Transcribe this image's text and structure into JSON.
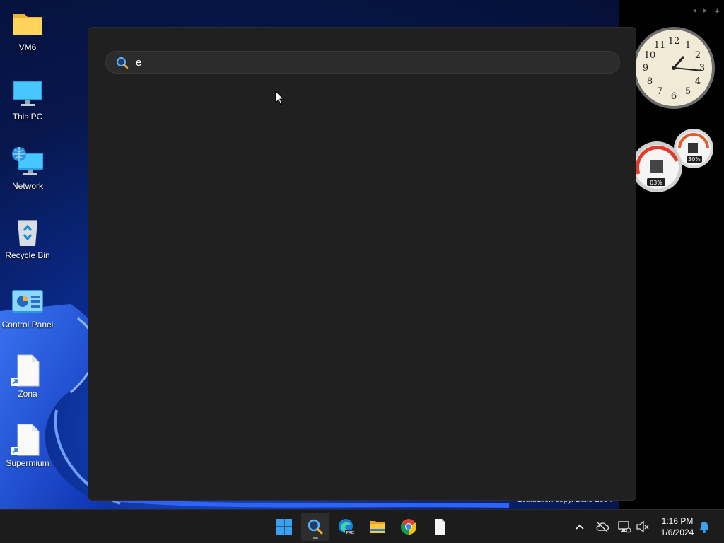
{
  "desktop": {
    "icons": [
      {
        "label": "VM6",
        "icon": "folder-icon"
      },
      {
        "label": "This PC",
        "icon": "monitor-icon"
      },
      {
        "label": "Network",
        "icon": "network-icon"
      },
      {
        "label": "Recycle Bin",
        "icon": "recycle-bin-icon"
      },
      {
        "label": "Control Panel",
        "icon": "control-panel-icon"
      },
      {
        "label": "Zona",
        "icon": "shortcut-file-icon"
      },
      {
        "label": "Supermium",
        "icon": "shortcut-file-icon"
      }
    ],
    "watermark": "Evaluation copy. Build 2594"
  },
  "gadgets": {
    "clock": {
      "numerals": [
        "12",
        "1",
        "2",
        "3",
        "4",
        "5",
        "6",
        "7",
        "8",
        "9",
        "10",
        "11"
      ],
      "time": "1:16"
    },
    "meters": {
      "cpu_label": "03%",
      "ram_label": "30%"
    },
    "controls": {
      "prev": "◂",
      "next": "▸",
      "add": "+"
    }
  },
  "search": {
    "query": "e",
    "icon": "search-icon"
  },
  "taskbar": {
    "apps": [
      {
        "name": "Start",
        "icon": "windows-start-icon"
      },
      {
        "name": "Search",
        "icon": "search-icon",
        "active": true
      },
      {
        "name": "Edge Beta",
        "icon": "edge-beta-icon",
        "badge": "PRE"
      },
      {
        "name": "File Explorer",
        "icon": "file-explorer-icon"
      },
      {
        "name": "Chrome",
        "icon": "chrome-icon"
      },
      {
        "name": "Notepad",
        "icon": "blank-document-icon"
      }
    ],
    "tray": {
      "time": "1:16 PM",
      "date": "1/6/2024"
    }
  },
  "colors": {
    "panel_bg": "#202020",
    "searchbox_bg": "#2c2c2c",
    "taskbar_bg": "#1c1c1c",
    "accent": "#0a78d7"
  }
}
